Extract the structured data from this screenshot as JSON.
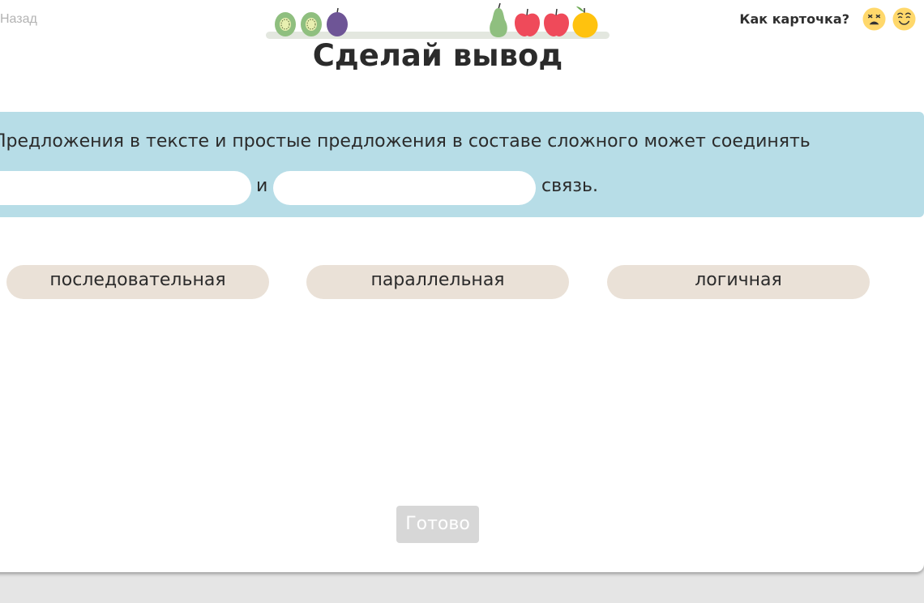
{
  "nav": {
    "back_label": "Назад"
  },
  "title": "Сделай вывод",
  "rating": {
    "label": "Как карточка?",
    "faces": [
      "sad-face-icon",
      "happy-face-icon"
    ]
  },
  "progress": {
    "fruits": [
      "kiwi",
      "kiwi",
      "plum",
      "pear",
      "apple",
      "apple",
      "orange"
    ]
  },
  "question": {
    "line1": "Предложения в тексте и простые предложения в составе сложного может соединять",
    "connector": "и",
    "ending": "связь.",
    "blanks": [
      "",
      ""
    ]
  },
  "options": [
    "последовательная",
    "параллельная",
    "логичная"
  ],
  "done_label": "Готово",
  "colors": {
    "question_bg": "#b7dde7",
    "option_bg": "#eae1d7",
    "done_disabled_bg": "#d7d7d7"
  }
}
